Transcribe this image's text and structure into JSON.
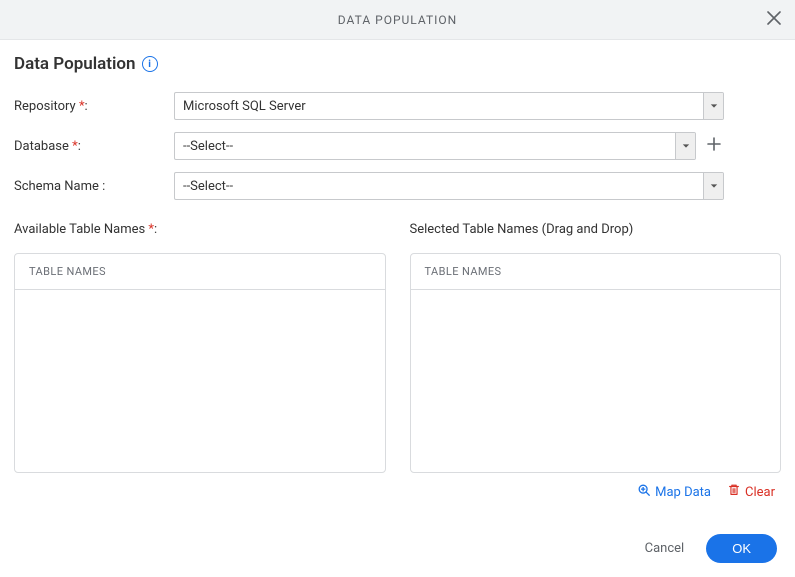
{
  "header": {
    "title": "DATA POPULATION"
  },
  "page": {
    "title": "Data Population"
  },
  "form": {
    "repository": {
      "label": "Repository ",
      "req": "*",
      "colon": ":",
      "value": "Microsoft SQL Server"
    },
    "database": {
      "label": "Database ",
      "req": "*",
      "colon": ":",
      "value": "--Select--"
    },
    "schema": {
      "label": "Schema Name :",
      "value": "--Select--"
    }
  },
  "tables": {
    "available": {
      "title": "Available Table Names ",
      "req": "*",
      "colon": ":",
      "header": "TABLE NAMES"
    },
    "selected": {
      "title": "Selected Table Names (Drag and Drop)",
      "header": "TABLE NAMES"
    }
  },
  "actions": {
    "map": "Map Data",
    "clear": "Clear"
  },
  "footer": {
    "cancel": "Cancel",
    "ok": "OK"
  }
}
